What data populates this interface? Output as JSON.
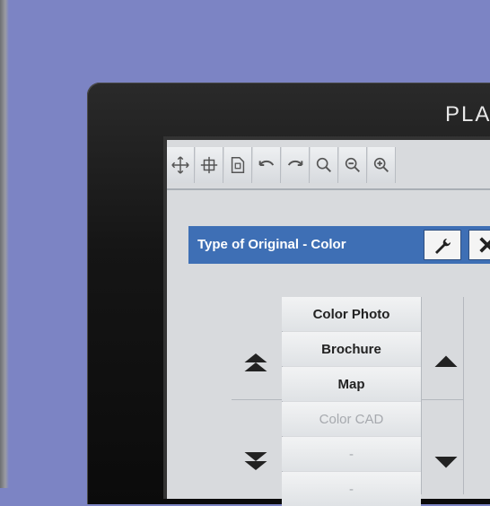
{
  "device": {
    "brand_text": "PLA"
  },
  "toolbar": {
    "tools": [
      {
        "icon": "move-icon"
      },
      {
        "icon": "pan-icon"
      },
      {
        "icon": "page-fit-icon"
      },
      {
        "icon": "undo-icon"
      },
      {
        "icon": "redo-icon"
      },
      {
        "icon": "zoom-icon"
      },
      {
        "icon": "zoom-out-icon"
      },
      {
        "icon": "zoom-in-icon"
      }
    ]
  },
  "panel": {
    "title": "Type of Original - Color",
    "wrench_icon": "wrench-icon",
    "close_icon": "close-icon",
    "items": [
      {
        "label": "Color Photo",
        "enabled": true
      },
      {
        "label": "Brochure",
        "enabled": true
      },
      {
        "label": "Map",
        "enabled": true
      },
      {
        "label": "Color CAD",
        "enabled": false
      },
      {
        "label": "-",
        "enabled": false
      },
      {
        "label": "-",
        "enabled": false
      }
    ]
  },
  "colors": {
    "background": "#7c84c4",
    "panel_header": "#3e6fb5",
    "screen": "#d8dadd"
  }
}
